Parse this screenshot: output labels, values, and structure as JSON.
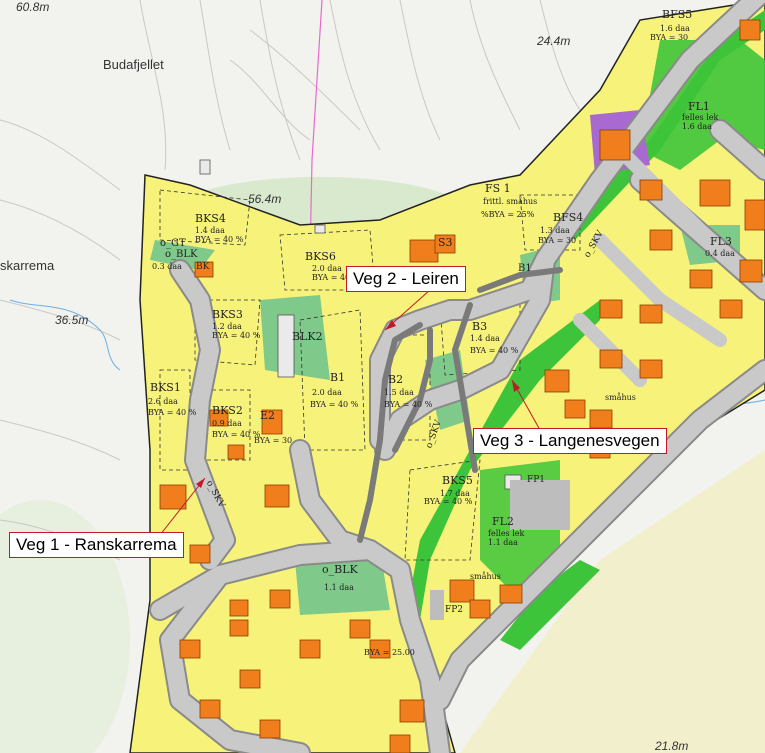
{
  "place_names": {
    "budafjellet": "Budafjellet",
    "ranskarrema": "skarrema"
  },
  "elevations": {
    "e1": "60.8m",
    "e2": "24.4m",
    "e3": "56.4m",
    "e4": "36.5m",
    "e5": "21.8m"
  },
  "callouts": {
    "veg1": "Veg 1 - Ranskarrema",
    "veg2": "Veg 2 - Leiren",
    "veg3": "Veg 3 - Langenesvegen"
  },
  "zones": {
    "bks4": {
      "name": "BKS4",
      "area": "1.4 daa",
      "bya": "BYA = 40 %"
    },
    "bks6": {
      "name": "BKS6",
      "area": "2.0 daa",
      "bya": "BYA = 40 %"
    },
    "bks3": {
      "name": "BKS3",
      "area": "1.2 daa",
      "bya": "BYA = 40 %"
    },
    "bks1": {
      "name": "BKS1",
      "area": "2.6 daa",
      "bya": "BYA = 40 %"
    },
    "bks2": {
      "name": "BKS2",
      "area": "0.9 daa",
      "bya": "BYA = 40 %"
    },
    "b1": {
      "name": "B1",
      "area": "2.0 daa",
      "bya": "BYA = 40 %"
    },
    "b2": {
      "name": "B2",
      "area": "1.5 daa",
      "bya": "BYA = 40 %"
    },
    "b3": {
      "name": "B3",
      "area": "1.4 daa",
      "bya": "BYA = 40 %"
    },
    "bks5": {
      "name": "BKS5",
      "area": "1.7 daa",
      "bya": "BYA = 40 %"
    },
    "bfs4": {
      "name": "BFS4",
      "area": "1.3 daa",
      "bya": "BYA = 30"
    },
    "bfs5": {
      "name": "BFS5",
      "area": "1.6 daa",
      "bya": "BYA = 30"
    },
    "fs1": {
      "name": "FS 1",
      "area": "frittl. småhus",
      "bya": "%BYA = 25%"
    },
    "fl1": {
      "name": "FL1",
      "area": "felles lek",
      "bya": "1.6 daa"
    },
    "fl2": {
      "name": "FL2",
      "area": "felles lek",
      "bya": "1.1 daa"
    },
    "fl3": {
      "name": "FL3",
      "area": "0.4 daa"
    },
    "oblk": {
      "name": "o_BLK",
      "area": "1.1 daa"
    },
    "misc": {
      "s3": "S3",
      "b1b": "B1",
      "bk": "BK",
      "blk2": "BLK2",
      "ogt": "o_GT",
      "oblk2": "o_BLK",
      "obvl": "0.3 daa",
      "e2": "E2",
      "fp1": "FP1",
      "fp2": "FP2",
      "oskv": "o_SKV",
      "bya30": "BYA = 30",
      "bya25": "BYA = 25.00",
      "smahus": "småhus"
    }
  },
  "colors": {
    "background": "#f2f2ee",
    "residential": "#f7f37a",
    "green_zone": "#7fc98a",
    "bright_green": "#3ec43a",
    "road": "#c9c9c9",
    "road_edge": "#8a8a8a",
    "building": "#f07e1c",
    "purple": "#a86ad0",
    "callout_border": "#c0192b",
    "pink_line": "#e86acb",
    "blue_stream": "#6ab0e8"
  }
}
